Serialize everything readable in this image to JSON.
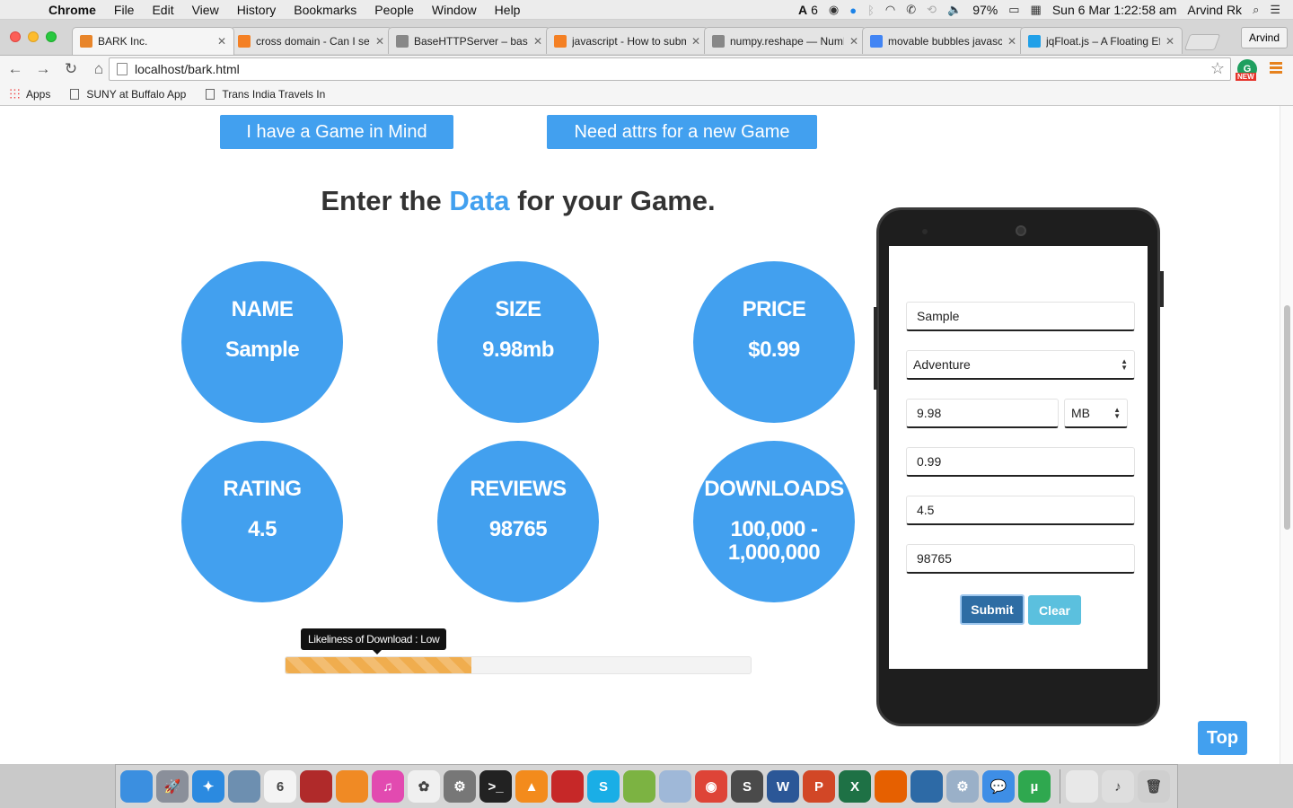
{
  "menubar": {
    "app": "Chrome",
    "items": [
      "File",
      "Edit",
      "View",
      "History",
      "Bookmarks",
      "People",
      "Window",
      "Help"
    ],
    "adobe_count": "6",
    "battery": "97%",
    "datetime": "Sun 6 Mar  1:22:58 am",
    "user": "Arvind Rk"
  },
  "tabs": [
    {
      "title": "BARK Inc.",
      "icon": "bark-favicon",
      "color": "#e8852a"
    },
    {
      "title": "cross domain - Can I set",
      "icon": "stackoverflow-favicon",
      "color": "#f48024"
    },
    {
      "title": "BaseHTTPServer – base",
      "icon": "page-favicon",
      "color": "#888888"
    },
    {
      "title": "javascript - How to subm",
      "icon": "stackoverflow-favicon",
      "color": "#f48024"
    },
    {
      "title": "numpy.reshape — NumP",
      "icon": "page-favicon",
      "color": "#888888"
    },
    {
      "title": "movable bubbles javasc",
      "icon": "google-favicon",
      "color": "#4285f4"
    },
    {
      "title": "jqFloat.js – A Floating Ef",
      "icon": "wordpress-favicon",
      "color": "#21a0e8"
    }
  ],
  "profile_name": "Arvind",
  "address": "localhost/bark.html",
  "extension_badge": "NEW",
  "bookmarks": [
    {
      "label": "Apps",
      "icon": "apps-grid-icon"
    },
    {
      "label": "SUNY at Buffalo App",
      "icon": "document-icon"
    },
    {
      "label": "Trans India Travels In",
      "icon": "document-icon"
    }
  ],
  "page": {
    "btn_game_in_mind": "I have a Game in Mind",
    "btn_need_attrs": "Need attrs for a new Game",
    "heading_pre": "Enter the ",
    "heading_accent": "Data",
    "heading_post": " for your Game.",
    "bubbles": [
      {
        "title": "NAME",
        "value": "Sample"
      },
      {
        "title": "SIZE",
        "value": "9.98mb"
      },
      {
        "title": "PRICE",
        "value": "$0.99"
      },
      {
        "title": "RATING",
        "value": "4.5"
      },
      {
        "title": "REVIEWS",
        "value": "98765"
      },
      {
        "title": "DOWNLOADS",
        "value": "100,000 - 1,000,000"
      }
    ],
    "tooltip": "Likeliness of Download : Low",
    "progress_fraction": 0.4,
    "accent_color": "#42a0ef",
    "progress_color": "#f0ad4e",
    "top_button": "Top"
  },
  "form": {
    "name": "Sample",
    "category": "Adventure",
    "size": "9.98",
    "size_unit": "MB",
    "price": "0.99",
    "rating": "4.5",
    "reviews": "98765",
    "submit": "Submit",
    "clear": "Clear"
  },
  "dock": [
    {
      "name": "finder-icon",
      "color": "#3b8fe0",
      "glyph": ""
    },
    {
      "name": "launchpad-icon",
      "color": "#8a8f9a",
      "glyph": "🚀"
    },
    {
      "name": "safari-icon",
      "color": "#2b8ae0",
      "glyph": "✦"
    },
    {
      "name": "preview-icon",
      "color": "#6d8fb0",
      "glyph": ""
    },
    {
      "name": "calendar-icon",
      "color": "#f4f4f4",
      "glyph": "6"
    },
    {
      "name": "photo-booth-icon",
      "color": "#b02a2a",
      "glyph": ""
    },
    {
      "name": "ibooks-icon",
      "color": "#f08a24",
      "glyph": ""
    },
    {
      "name": "itunes-icon",
      "color": "#e24ab0",
      "glyph": "♫"
    },
    {
      "name": "photos-icon",
      "color": "#f0f0f0",
      "glyph": "✿"
    },
    {
      "name": "system-preferences-icon",
      "color": "#777777",
      "glyph": "⚙"
    },
    {
      "name": "terminal-icon",
      "color": "#222222",
      "glyph": ">_"
    },
    {
      "name": "vlc-icon",
      "color": "#f38b1c",
      "glyph": "▲"
    },
    {
      "name": "red-app-icon",
      "color": "#c62828",
      "glyph": ""
    },
    {
      "name": "skype-icon",
      "color": "#1aaee6",
      "glyph": "S"
    },
    {
      "name": "android-icon",
      "color": "#7cb342",
      "glyph": ""
    },
    {
      "name": "virtualbox-icon",
      "color": "#9fb8d8",
      "glyph": ""
    },
    {
      "name": "chrome-icon",
      "color": "#de4437",
      "glyph": "◉"
    },
    {
      "name": "sublime-icon",
      "color": "#4a4a4a",
      "glyph": "S"
    },
    {
      "name": "word-icon",
      "color": "#2b5797",
      "glyph": "W"
    },
    {
      "name": "powerpoint-icon",
      "color": "#d24726",
      "glyph": "P"
    },
    {
      "name": "excel-icon",
      "color": "#1e7145",
      "glyph": "X"
    },
    {
      "name": "firefox-icon",
      "color": "#e66000",
      "glyph": ""
    },
    {
      "name": "mysql-workbench-icon",
      "color": "#2d6aa6",
      "glyph": ""
    },
    {
      "name": "utility-icon",
      "color": "#9ab0c8",
      "glyph": "⚙"
    },
    {
      "name": "messages-icon",
      "color": "#3e8ee6",
      "glyph": "💬"
    },
    {
      "name": "utorrent-icon",
      "color": "#2fa84f",
      "glyph": "µ"
    },
    {
      "name": "torrent-file-icon",
      "color": "#e8e8e8",
      "glyph": ""
    },
    {
      "name": "music-folder-icon",
      "color": "#dedede",
      "glyph": "♪"
    },
    {
      "name": "trash-icon",
      "color": "#cfcfcf",
      "glyph": "🗑"
    }
  ]
}
